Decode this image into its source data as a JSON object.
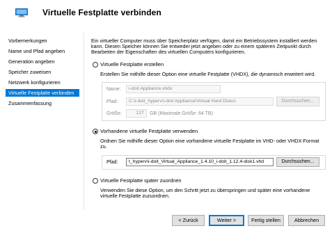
{
  "header": {
    "title": "Virtuelle Festplatte verbinden",
    "icon": "virtual-disk-icon"
  },
  "sidebar": {
    "items": [
      {
        "label": "Vorbemerkungen",
        "active": false
      },
      {
        "label": "Name und Pfad angeben",
        "active": false
      },
      {
        "label": "Generation angeben",
        "active": false
      },
      {
        "label": "Speicher zuweisen",
        "active": false
      },
      {
        "label": "Netzwerk konfigurieren",
        "active": false
      },
      {
        "label": "Virtuelle Festplatte verbinden",
        "active": true
      },
      {
        "label": "Zusammenfassung",
        "active": false
      }
    ]
  },
  "main": {
    "intro": [
      "Ein virtueller Computer muss über Speicherplatz verfügen, damit ein Betriebssystem installiert werden",
      "kann. Diesen Speicher können Sie entweder jetzt angeben oder zu einem späteren Zeitpunkt durch",
      "Bearbeiten der Eigenschaften des virtuellen Computers konfigurieren."
    ],
    "option_create": {
      "label": "Virtuelle Festplatte erstellen",
      "selected": false,
      "description": "Erstellen Sie mithilfe dieser Option eine virtuelle Festplatte (VHDX), die dynamisch erweitert wird.",
      "name_label": "Name:",
      "name_value": "i-doit Appliance.vhdx",
      "path_label": "Pfad:",
      "path_value": "C:\\i-doit_hyperv\\i-doit Appliance\\Virtual Hard Disks\\",
      "browse_label": "Durchsuchen...",
      "size_label": "Größe:",
      "size_value": "127",
      "size_unit": "GB (Maximale Größe: 64 TB)"
    },
    "option_existing": {
      "label": "Vorhandene virtuelle Festplatte verwenden",
      "selected": true,
      "description": [
        "Ordnen Sie mithilfe dieser Option eine vorhandene virtuelle Festplatte im VHD- oder VHDX-Format",
        "zu."
      ],
      "path_label": "Pfad:",
      "path_value": "t_hyperv\\i-doit_Virtual_Appliance_1.4.10_i-doit_1.12.4-disk1.vhd",
      "browse_label": "Durchsuchen..."
    },
    "option_later": {
      "label": "Virtuelle Festplatte später zuordnen",
      "selected": false,
      "description": [
        "Verwenden Sie diese Option, um den Schritt jetzt zu überspringen und später eine vorhandene",
        "virtuelle Festplatte zuzuordnen."
      ]
    }
  },
  "footer": {
    "back_label": "< Zurück",
    "next_label": "Weiter >",
    "finish_label": "Fertig stellen",
    "cancel_label": "Abbrechen"
  },
  "colors": {
    "accent": "#0078d7"
  }
}
